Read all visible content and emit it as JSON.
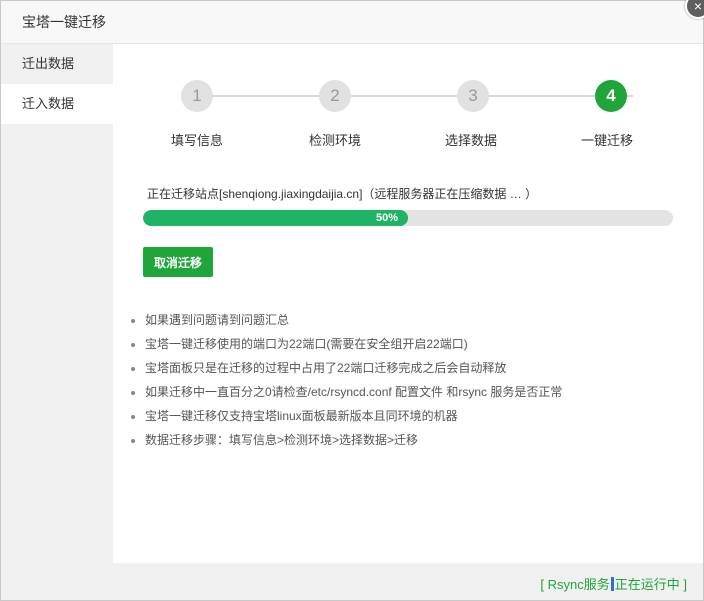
{
  "dialog": {
    "title": "宝塔一键迁移",
    "close_label": "×"
  },
  "sidebar": {
    "items": [
      {
        "label": "迁出数据",
        "active": false
      },
      {
        "label": "迁入数据",
        "active": true
      }
    ]
  },
  "steps": [
    {
      "number": "1",
      "label": "填写信息",
      "active": false
    },
    {
      "number": "2",
      "label": "检测环境",
      "active": false
    },
    {
      "number": "3",
      "label": "选择数据",
      "active": false
    },
    {
      "number": "4",
      "label": "一键迁移",
      "active": true
    }
  ],
  "migration": {
    "status_text": "正在迁移站点[shenqiong.jiaxingdaijia.cn]（远程服务器正在压缩数据 … ）",
    "progress_percent": 50,
    "progress_label": "50%",
    "cancel_button": "取消迁移"
  },
  "tips": [
    "如果遇到问题请到问题汇总",
    "宝塔一键迁移使用的端口为22端口(需要在安全组开启22端口)",
    "宝塔面板只是在迁移的过程中占用了22端口迁移完成之后会自动释放",
    "如果迁移中一直百分之0请检查/etc/rsyncd.conf 配置文件 和rsync 服务是否正常",
    "宝塔一键迁移仅支持宝塔linux面板最新版本且同环境的机器",
    "数据迁移步骤：填写信息>检测环境>选择数据>迁移"
  ],
  "footer": {
    "rsync_prefix": "[ Rsync服务",
    "rsync_suffix": "正在运行中 ]"
  },
  "colors": {
    "accent": "#20a53a",
    "progress": "#20b365",
    "inactive_step": "#e1e1e1"
  }
}
